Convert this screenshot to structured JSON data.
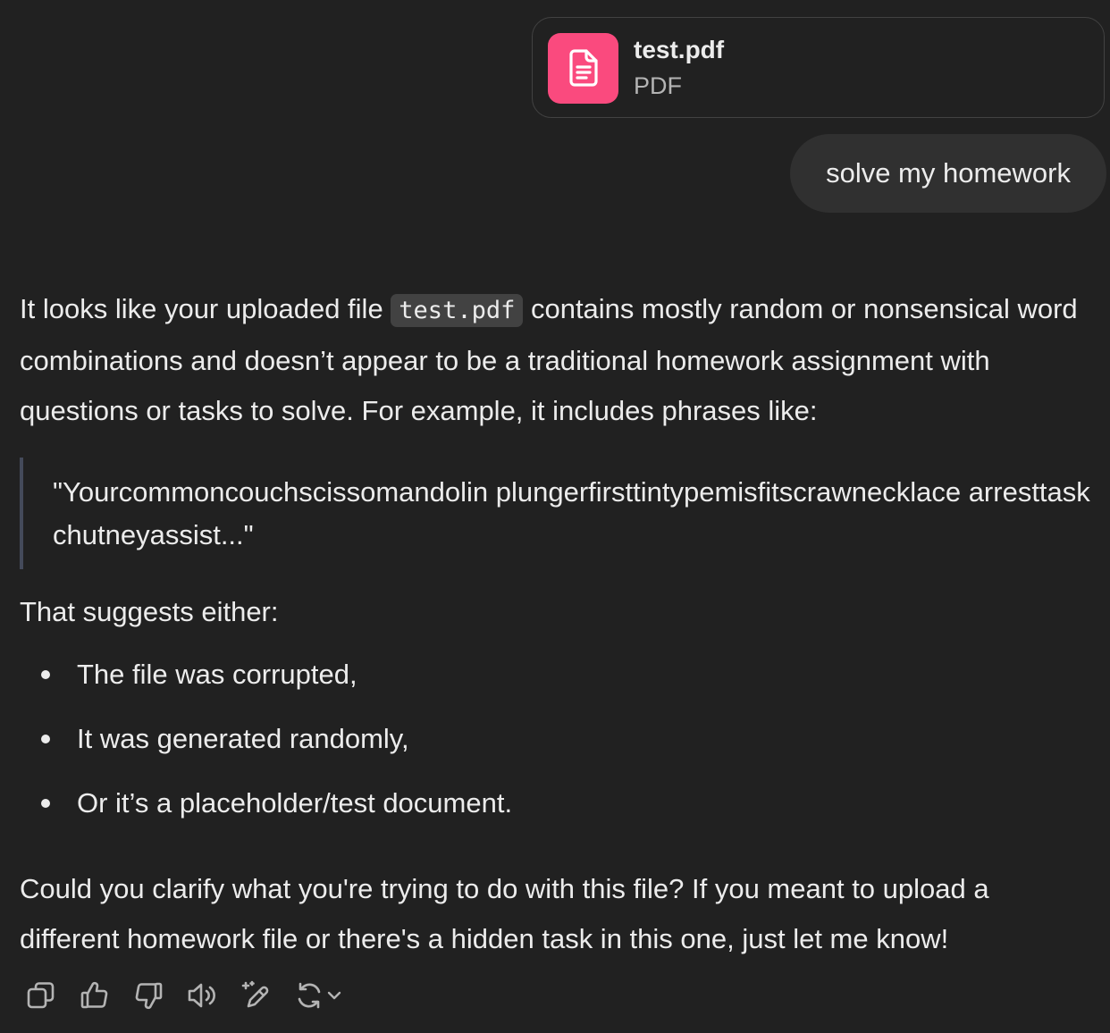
{
  "attachment": {
    "file_name": "test.pdf",
    "file_type": "PDF",
    "icon": "file-document-icon",
    "icon_color": "#fa4a7e"
  },
  "user_message": {
    "text": "solve my homework"
  },
  "assistant": {
    "intro_before_code": "It looks like your uploaded file ",
    "intro_code": "test.pdf",
    "intro_after_code": " contains mostly random or nonsensical word combinations and doesn’t appear to be a traditional homework assignment with questions or tasks to solve. For example, it includes phrases like:",
    "quote": "\"Yourcommoncouchscissomandolin plungerfirsttintypemisfitscrawnecklace arresttask chutneyassist...\"",
    "suggest_intro": "That suggests either:",
    "bullets": [
      "The file was corrupted,",
      "It was generated randomly,",
      "Or it’s a placeholder/test document."
    ],
    "closing": "Could you clarify what you're trying to do with this file? If you meant to upload a different homework file or there's a hidden task in this one, just let me know!"
  },
  "toolbar": {
    "icons": [
      "copy-icon",
      "thumbs-up-icon",
      "thumbs-down-icon",
      "read-aloud-icon",
      "edit-sparkle-icon",
      "regenerate-icon",
      "chevron-down-icon"
    ],
    "icon_color": "#b4b4b4"
  },
  "colors": {
    "background": "#212121",
    "bubble": "#303030",
    "text": "#ececec",
    "muted": "#b4b4b4"
  }
}
